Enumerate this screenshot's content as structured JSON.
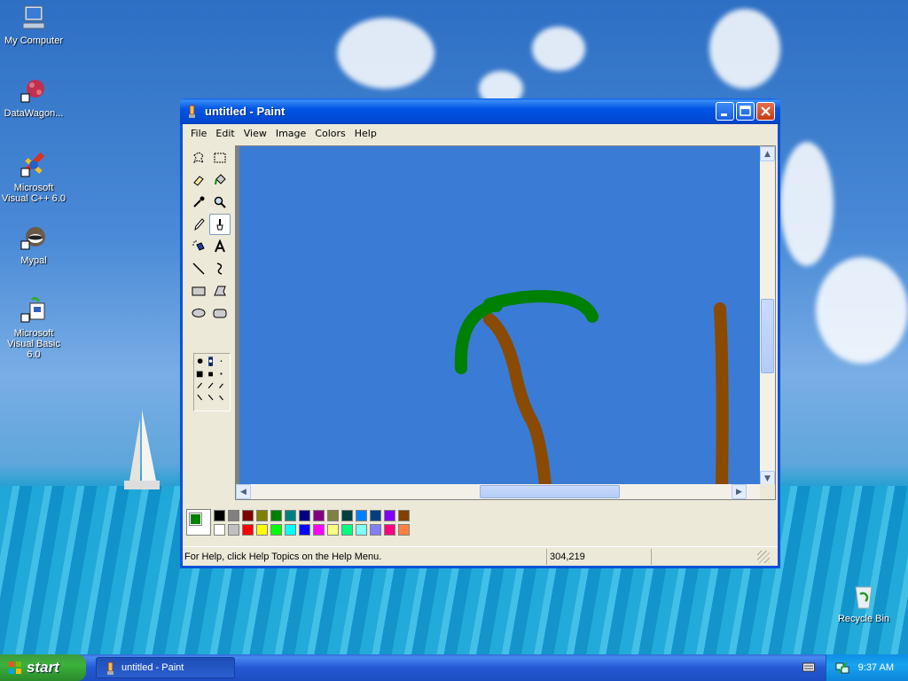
{
  "desktop": {
    "icons": [
      {
        "label": "My Computer"
      },
      {
        "label": "DataWagon..."
      },
      {
        "label": "Microsoft Visual C++ 6.0"
      },
      {
        "label": "Mypal"
      },
      {
        "label": "Microsoft Visual Basic 6.0"
      },
      {
        "label": "Recycle Bin"
      }
    ]
  },
  "window": {
    "title": "untitled - Paint",
    "menu": [
      "File",
      "Edit",
      "View",
      "Image",
      "Colors",
      "Help"
    ],
    "tools": [
      "free-form-select",
      "select",
      "eraser",
      "fill-with-color",
      "pick-color",
      "magnifier",
      "pencil",
      "brush",
      "airbrush",
      "text",
      "line",
      "curve",
      "rectangle",
      "polygon",
      "ellipse",
      "rounded-rectangle"
    ],
    "selected_tool": "brush",
    "canvas_background": "#3a7bd5",
    "foreground_color": "#008000",
    "background_color": "#ffffff",
    "palette_row1": [
      "#000000",
      "#808080",
      "#800000",
      "#808000",
      "#008000",
      "#008080",
      "#000080",
      "#800080",
      "#808040",
      "#004040",
      "#0080ff",
      "#004080",
      "#8000ff",
      "#804000"
    ],
    "palette_row2": [
      "#ffffff",
      "#c0c0c0",
      "#ff0000",
      "#ffff00",
      "#00ff00",
      "#00ffff",
      "#0000ff",
      "#ff00ff",
      "#ffff80",
      "#00ff80",
      "#80ffff",
      "#8080ff",
      "#ff0080",
      "#ff8040"
    ],
    "status_help": "For Help, click Help Topics on the Help Menu.",
    "status_coords": "304,219"
  },
  "taskbar": {
    "start_label": "start",
    "task_button": "untitled - Paint",
    "clock": "9:37 AM"
  }
}
